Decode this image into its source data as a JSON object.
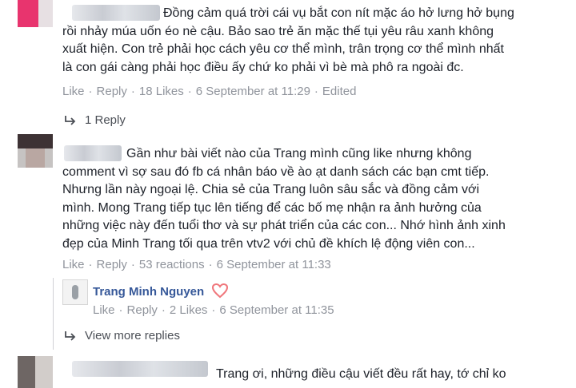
{
  "comments": [
    {
      "text_lines": [
        "Đồng cảm quá trời cái vụ bắt con nít mặc áo hở lưng hở bụng",
        "rồi nhảy múa uốn éo nè cậu. Bảo sao trẻ ăn mặc thế tụi yêu râu xanh không",
        "xuất hiện. Con trẻ phải học cách yêu cơ thể mình, trân trọng cơ thể mình nhất",
        "là con gái càng phải học điều ấy chứ ko phải vì bè mà phô ra ngoài đc."
      ],
      "like": "Like",
      "reply": "Reply",
      "count": "18 Likes",
      "date": "6 September at 11:29",
      "edited": "Edited",
      "replies_label": "1 Reply"
    },
    {
      "text_lines": [
        "Gần như bài viết nào của Trang mình cũng like nhưng không",
        "comment vì sợ sau đó fb cá nhân báo về ào ạt danh sách các bạn cmt tiếp.",
        "Nhưng lần này ngoại lệ. Chia sẻ của Trang luôn sâu sắc và đồng cảm với",
        "mình. Mong Trang tiếp tục lên tiếng để các bố mẹ nhận ra ảnh hưởng của",
        "những việc này đến tuổi thơ và sự phát triển của các con... Nhớ hình ảnh xinh",
        "đẹp của Minh Trang tối qua trên vtv2 với chủ đề khích lệ động viên con..."
      ],
      "like": "Like",
      "reply": "Reply",
      "count": "53 reactions",
      "date": "6 September at 11:33"
    },
    {
      "text_first": "Trang ơi, những điều cậu viết đều rất hay, tớ chỉ ko"
    }
  ],
  "reply": {
    "author": "Trang Minh Nguyen",
    "like": "Like",
    "reply": "Reply",
    "count": "2 Likes",
    "date": "6 September at 11:35",
    "more_replies_label": "View more replies"
  },
  "colors": {
    "link": "#365899",
    "meta": "#90949c",
    "heart": "#f0767b"
  },
  "icons": {
    "reply_arrow": "reply-arrow-icon",
    "heart": "heart-reaction-icon"
  }
}
